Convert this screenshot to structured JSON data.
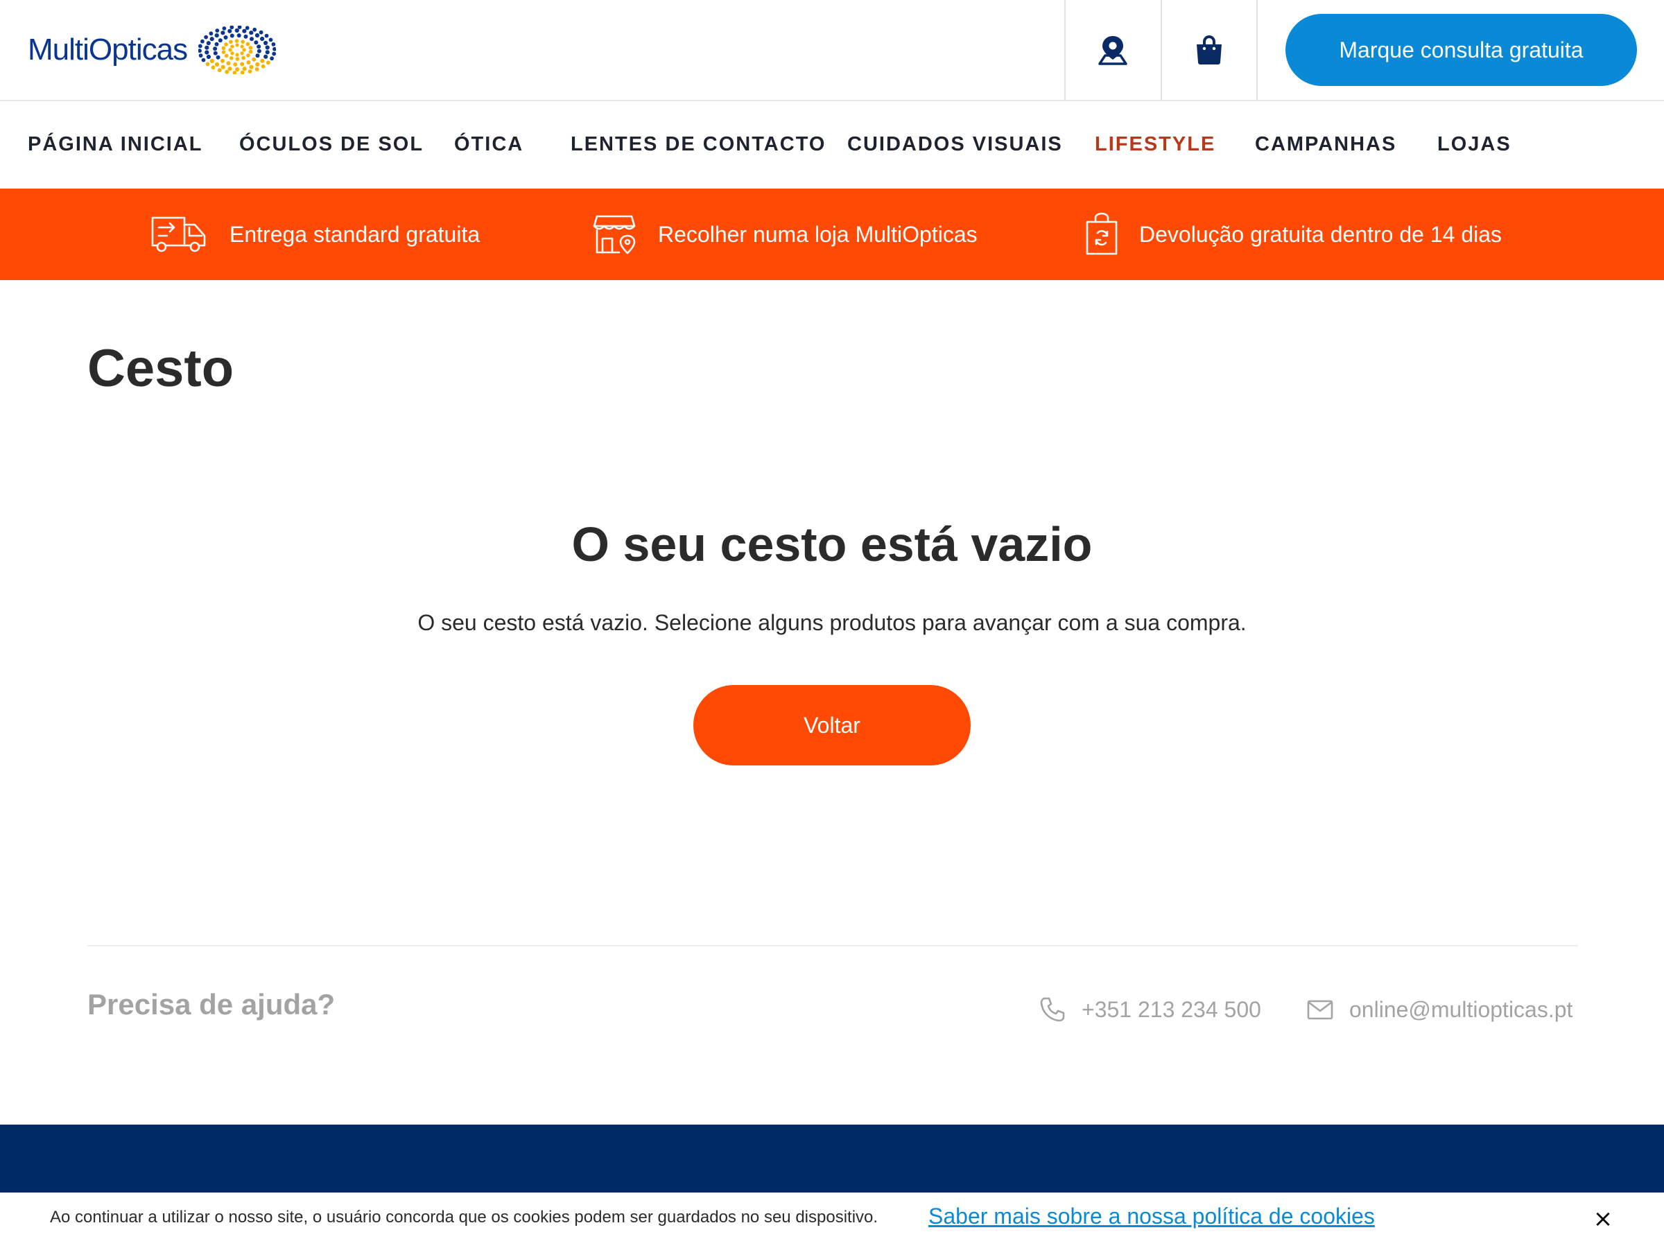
{
  "header": {
    "logo_text": "MultiOpticas",
    "cta_label": "Marque consulta gratuita",
    "icons": [
      "location-pin-icon",
      "shopping-bag-icon"
    ]
  },
  "nav": {
    "items": [
      {
        "label": "PÁGINA INICIAL"
      },
      {
        "label": "ÓCULOS DE SOL"
      },
      {
        "label": "ÓTICA"
      },
      {
        "label": "LENTES DE CONTACTO"
      },
      {
        "label": "CUIDADOS VISUAIS"
      },
      {
        "label": "LIFESTYLE"
      },
      {
        "label": "CAMPANHAS"
      },
      {
        "label": "LOJAS"
      }
    ]
  },
  "benefits": [
    {
      "icon": "delivery-truck-icon",
      "label": "Entrega standard gratuita"
    },
    {
      "icon": "store-pickup-icon",
      "label": "Recolher numa loja MultiOpticas"
    },
    {
      "icon": "return-bag-icon",
      "label": "Devolução gratuita dentro de 14 dias"
    }
  ],
  "main": {
    "page_title": "Cesto",
    "empty_title": "O seu cesto está vazio",
    "empty_description": "O seu cesto está vazio. Selecione alguns produtos para avançar com a sua compra.",
    "back_label": "Voltar"
  },
  "help": {
    "title": "Precisa de ajuda?",
    "phone": "+351 213 234 500",
    "email": "online@multiopticas.pt"
  },
  "cookie": {
    "text": "Ao continuar a utilizar o nosso site, o usuário concorda que os cookies podem ser guardados no seu dispositivo.",
    "link": "Saber mais sobre a nossa política de cookies",
    "close": "×"
  },
  "colors": {
    "brand_blue": "#0a3690",
    "cta_blue": "#0a8ad6",
    "accent_orange": "#ff4a05",
    "footer_navy": "#002a66",
    "lifestyle_red": "#b8391a"
  }
}
